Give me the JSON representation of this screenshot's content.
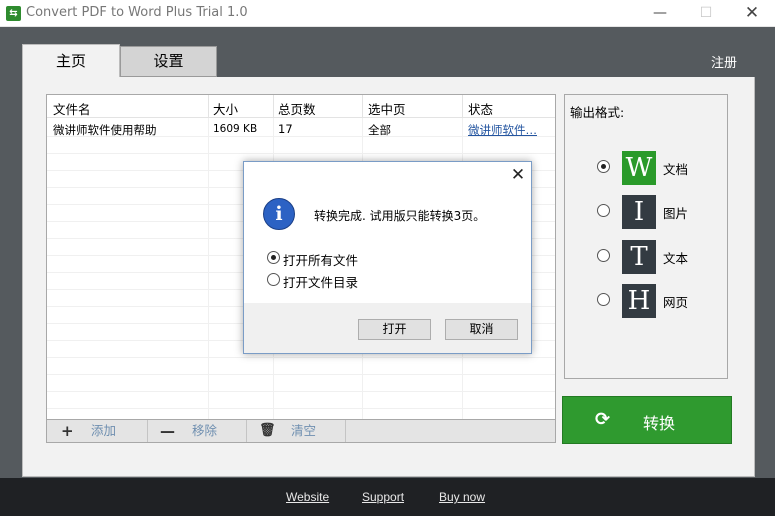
{
  "window": {
    "title": "Convert PDF to Word Plus Trial 1.0",
    "min_glyph": "—",
    "max_glyph": "☐",
    "close_glyph": "✕"
  },
  "tabs": [
    {
      "label": "主页",
      "active": true
    },
    {
      "label": "设置",
      "active": false
    }
  ],
  "register_label": "注册",
  "table": {
    "columns": [
      "文件名",
      "大小",
      "总页数",
      "选中页",
      "状态"
    ],
    "rows": [
      {
        "name": "微讲师软件使用帮助",
        "size": "1609 KB",
        "pages": "17",
        "selected": "全部",
        "status": "微讲师软件…"
      }
    ]
  },
  "toolbar": {
    "add_label": "添加",
    "remove_label": "移除",
    "clear_label": "清空"
  },
  "output_format": {
    "title": "输出格式:",
    "options": [
      {
        "letter": "W",
        "label": "文档",
        "checked": true
      },
      {
        "letter": "I",
        "label": "图片",
        "checked": false
      },
      {
        "letter": "T",
        "label": "文本",
        "checked": false
      },
      {
        "letter": "H",
        "label": "网页",
        "checked": false
      }
    ]
  },
  "convert_label": "转换",
  "dialog": {
    "message": "转换完成. 试用版只能转换3页。",
    "options": [
      {
        "label": "打开所有文件",
        "checked": true
      },
      {
        "label": "打开文件目录",
        "checked": false
      }
    ],
    "ok_label": "打开",
    "cancel_label": "取消"
  },
  "footer": {
    "links": [
      "Website",
      "Support",
      "Buy now"
    ]
  },
  "colors": {
    "accent_green": "#2f9a2f",
    "main_bg": "#555a5e",
    "footer_bg": "#1f2124",
    "link_blue": "#2455a0"
  },
  "icons": [
    "app-icon",
    "plus-icon",
    "minus-icon",
    "trash-icon",
    "sync-icon",
    "info-icon",
    "close-icon"
  ]
}
